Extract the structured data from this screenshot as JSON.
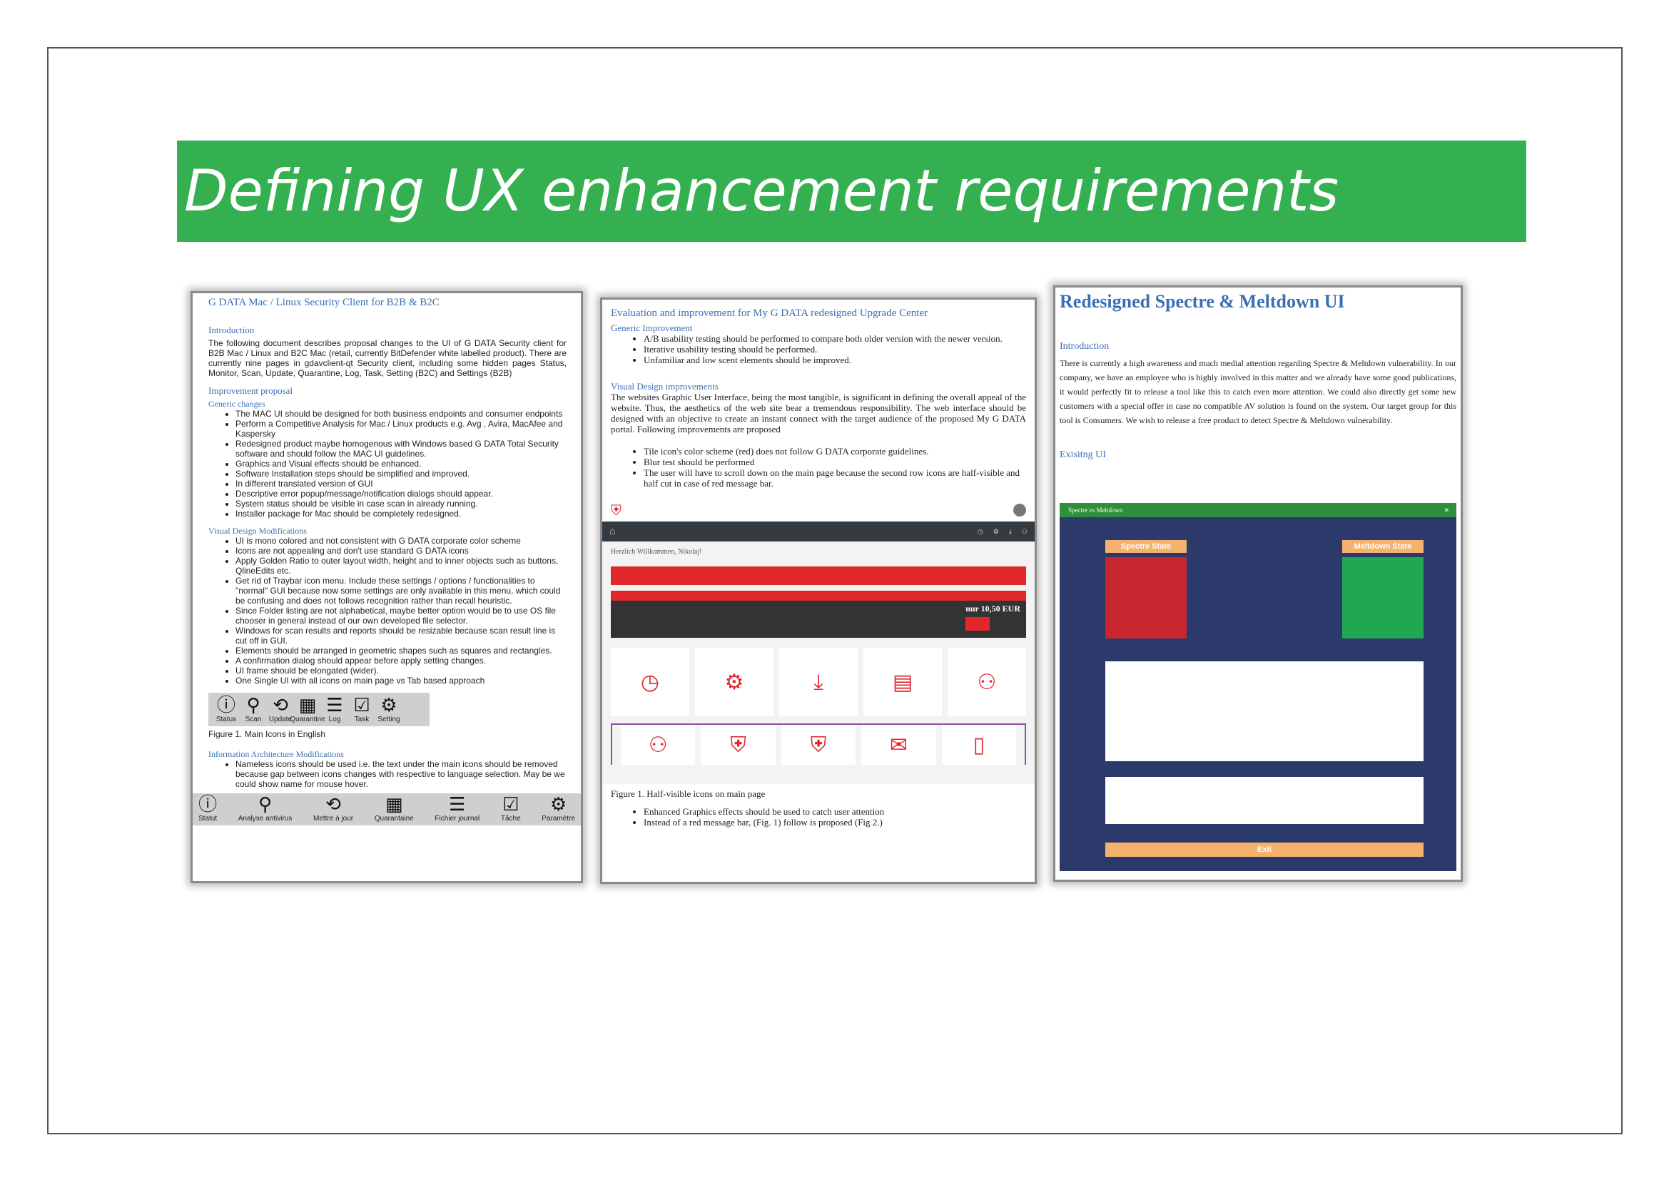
{
  "slide": {
    "title": "Defining UX enhancement requirements",
    "accent_color": "#34b051"
  },
  "doc1": {
    "title": "G DATA Mac / Linux Security Client for B2B & B2C",
    "intro_heading": "Introduction",
    "intro_text": "The following document describes proposal changes to the UI of G DATA Security client for B2B Mac / Linux and B2C Mac (retail, currently BitDefender white labelled product). There are currently nine pages in gdavclient-qt Security client, including some hidden pages Status, Monitor, Scan, Update, Quarantine, Log, Task, Setting (B2C) and Settings (B2B)",
    "improvement_heading": "Improvement proposal",
    "generic_heading": "Generic changes",
    "generic_items": [
      "The MAC UI should be designed for both business endpoints and consumer endpoints",
      "Perform a Competitive Analysis for Mac / Linux products e.g. Avg , Avira, MacAfee and Kaspersky",
      "Redesigned product maybe homogenous with Windows based G DATA Total Security software and should follow the MAC UI guidelines.",
      "Graphics and Visual effects should be enhanced.",
      "Software Installation steps should be simplified and improved.",
      "In different translated version of GUI",
      "Descriptive error popup/message/notification dialogs should appear.",
      "System status should be visible in case scan in already running.",
      "Installer package for Mac should be completely redesigned."
    ],
    "visual_heading": "Visual Design Modifications",
    "visual_items": [
      "UI is mono colored and not consistent with G DATA corporate color scheme",
      "Icons are not appealing and don't use standard G DATA icons",
      "Apply Golden Ratio to outer layout width, height and to inner objects such as buttons, QlineEdits etc.",
      "Get rid of Traybar icon menu. Include these settings / options / functionalities to \"normal\" GUI because now some settings are only available in this menu, which could be confusing and does not follows recognition rather than recall heuristic.",
      "Since Folder listing are not alphabetical, maybe better option would be to use OS file chooser in general instead of our own developed file selector.",
      "Windows for scan results and reports should be resizable because scan result line is cut off in GUI.",
      "Elements should be arranged in geometric shapes such as squares and rectangles.",
      "A confirmation dialog should appear before apply setting changes.",
      "UI frame should be elongated (wider).",
      "One Single UI with all icons on main page vs Tab based approach"
    ],
    "icons_en": [
      {
        "glyph": "ⓘ",
        "label": "Status"
      },
      {
        "glyph": "⚲",
        "label": "Scan"
      },
      {
        "glyph": "⟲",
        "label": "Update"
      },
      {
        "glyph": "▦",
        "label": "Quarantine"
      },
      {
        "glyph": "☰",
        "label": "Log"
      },
      {
        "glyph": "☑",
        "label": "Task"
      },
      {
        "glyph": "⚙",
        "label": "Setting"
      }
    ],
    "figure1_caption": "Figure 1. Main Icons in English",
    "ia_heading": "Information Architecture Modifications",
    "ia_items": [
      "Nameless icons should be used i.e. the text under the main icons should be removed because gap between icons changes with respective to language selection. May be we could show name for mouse hover."
    ],
    "icons_fr": [
      {
        "glyph": "ⓘ",
        "label": "Statut"
      },
      {
        "glyph": "⚲",
        "label": "Analyse antivirus"
      },
      {
        "glyph": "⟲",
        "label": "Mettre à jour"
      },
      {
        "glyph": "▦",
        "label": "Quarantaine"
      },
      {
        "glyph": "☰",
        "label": "Fichier journal"
      },
      {
        "glyph": "☑",
        "label": "Tâche"
      },
      {
        "glyph": "⚙",
        "label": "Paramètre"
      }
    ]
  },
  "doc2": {
    "title": "Evaluation and improvement for My G DATA redesigned Upgrade Center",
    "generic_heading": "Generic Improvement",
    "generic_items": [
      "A/B usability testing should be performed to compare both older version with the newer version.",
      "Iterative usability testing should be performed.",
      "Unfamiliar and low scent elements should be improved."
    ],
    "visual_heading": "Visual Design improvements",
    "visual_text": "The websites Graphic User Interface, being the most tangible, is significant in defining the overall appeal of the website. Thus, the aesthetics of the web site bear a tremendous responsibility. The web interface should be designed with an objective to create an instant connect with the target audience of the proposed My G DATA portal. Following improvements are proposed",
    "visual_items": [
      "Tile icon's color scheme (red) does not follow G DATA corporate guidelines.",
      "Blur test should be performed",
      "The user will have to scroll down on the main page because the second row icons are half-visible and half cut in case of red message bar."
    ],
    "mock": {
      "welcome": "Herzlich Willkommen, Nikolaj!",
      "price": "nur 10,50 EUR",
      "tile_icons": [
        "◷",
        "⚙",
        "⤓",
        "▤",
        "⚇"
      ],
      "tile_icons2": [
        "⚇",
        "⛨",
        "⛨",
        "✉",
        "▯"
      ],
      "brand_red": "#e1262c"
    },
    "figure_caption": "Figure 1. Half-visible icons on main page",
    "after_items": [
      "Enhanced Graphics effects should be used to catch user attention",
      "Instead of a red message bar, (Fig. 1) follow is proposed (Fig 2.)"
    ]
  },
  "doc3": {
    "title": "Redesigned Spectre & Meltdown UI",
    "intro_heading": "Introduction",
    "intro_text": "There is currently a high awareness and much medial attention regarding Spectre & Meltdown vulnerability. In our company, we have an employee who is highly involved in this matter and we already have some good publications, it would perfectly fit to release a tool like this to catch even more attention. We could also directly get some new customers with a special offer in case no compatible AV solution is found on the system. Our target group for this tool is Consumers. We wish to release a free product to detect Spectre & Meltdown vulnerability.",
    "existing_heading": "Exisitng UI",
    "window": {
      "title": "Spectre vs Meltdown",
      "spectre_label": "Spectre State",
      "meltdown_label": "Meltdown State",
      "spectre_color": "#c8262e",
      "meltdown_color": "#1fa84f",
      "exit_label": "Exit"
    }
  }
}
